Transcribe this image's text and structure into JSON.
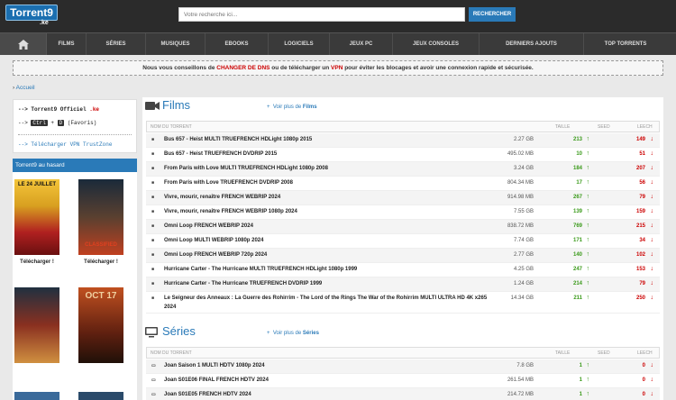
{
  "site": {
    "logo_text": "Torrent9",
    "logo_ext": ".ke"
  },
  "search": {
    "placeholder": "Votre recherche ici...",
    "button": "RECHERCHER"
  },
  "nav": [
    "FILMS",
    "SÉRIES",
    "MUSIQUES",
    "EBOOKS",
    "LOGICIELS",
    "JEUX PC",
    "JEUX CONSOLES",
    "DERNIERS AJOUTS",
    "TOP TORRENTS"
  ],
  "notice": {
    "pre": "Nous vous conseillons de ",
    "link1": "CHANGER DE DNS",
    "mid": " ou de télécharger un ",
    "link2": "VPN",
    "post": " pour éviter les blocages et avoir une connexion rapide et sécurisée."
  },
  "breadcrumb": "Accueil",
  "sidebar": {
    "line1_prefix": "--> Torrent9 Officiel ",
    "line1_ext": ".ke",
    "line2_prefix": "--> ",
    "key_ctrl": "Ctrl",
    "plus": "+",
    "key_d": "D",
    "line2_suffix": "(Favoris)",
    "line3": "--> Télécharger VPN TrustZone",
    "random_title": "Torrent9 au hasard",
    "caption": "Télécharger !",
    "p1": "LE 24 JUILLET",
    "p2": "CLASSIFIED",
    "p4": "OCT 17"
  },
  "films": {
    "title": "Films",
    "more_prefix": "Voir plus de ",
    "more_bold": "Films",
    "headers": {
      "name": "NOM DU TORRENT",
      "size": "TAILLE",
      "seed": "SEED",
      "leech": "LEECH"
    },
    "rows": [
      {
        "name": "Bus 657 - Heist MULTI TRUEFRENCH HDLight 1080p 2015",
        "size": "2.27 GB",
        "seed": "213",
        "leech": "149"
      },
      {
        "name": "Bus 657 - Heist TRUEFRENCH DVDRIP 2015",
        "size": "495.02 MB",
        "seed": "10",
        "leech": "51"
      },
      {
        "name": "From Paris with Love MULTI TRUEFRENCH HDLight 1080p 2008",
        "size": "3.24 GB",
        "seed": "184",
        "leech": "207"
      },
      {
        "name": "From Paris with Love TRUEFRENCH DVDRIP 2008",
        "size": "804.34 MB",
        "seed": "17",
        "leech": "56"
      },
      {
        "name": "Vivre, mourir, renaître FRENCH WEBRIP 2024",
        "size": "914.98 MB",
        "seed": "267",
        "leech": "79"
      },
      {
        "name": "Vivre, mourir, renaître FRENCH WEBRIP 1080p 2024",
        "size": "7.55 GB",
        "seed": "139",
        "leech": "159"
      },
      {
        "name": "Omni Loop FRENCH WEBRIP 2024",
        "size": "838.72 MB",
        "seed": "769",
        "leech": "215"
      },
      {
        "name": "Omni Loop MULTI WEBRIP 1080p 2024",
        "size": "7.74 GB",
        "seed": "171",
        "leech": "34"
      },
      {
        "name": "Omni Loop FRENCH WEBRIP 720p 2024",
        "size": "2.77 GB",
        "seed": "140",
        "leech": "102"
      },
      {
        "name": "Hurricane Carter - The Hurricane MULTI TRUEFRENCH HDLight 1080p 1999",
        "size": "4.25 GB",
        "seed": "247",
        "leech": "153"
      },
      {
        "name": "Hurricane Carter - The Hurricane TRUEFRENCH DVDRIP 1999",
        "size": "1.24 GB",
        "seed": "214",
        "leech": "79"
      },
      {
        "name": "Le Seigneur des Anneaux : La Guerre des Rohirrim - The Lord of the Rings The War of the Rohirrim MULTI ULTRA HD 4K x265",
        "name2": "2024",
        "size": "14.34 GB",
        "seed": "211",
        "leech": "250"
      }
    ]
  },
  "series": {
    "title": "Séries",
    "more_prefix": "Voir plus de ",
    "more_bold": "Séries",
    "headers": {
      "name": "NOM DU TORRENT",
      "size": "TAILLE",
      "seed": "SEED",
      "leech": "LEECH"
    },
    "rows": [
      {
        "name": "Joan Saison 1 MULTI HDTV 1080p 2024",
        "size": "7.8 GB",
        "seed": "1",
        "leech": "0"
      },
      {
        "name": "Joan S01E06 FINAL FRENCH HDTV 2024",
        "size": "261.54 MB",
        "seed": "1",
        "leech": "0"
      },
      {
        "name": "Joan S01E05 FRENCH HDTV 2024",
        "size": "214.72 MB",
        "seed": "1",
        "leech": "0"
      }
    ]
  },
  "colors": {
    "accent": "#2a7ab8",
    "seed": "#3a9a1a",
    "leech": "#cc0000",
    "topbar": "#2b2b2b"
  }
}
